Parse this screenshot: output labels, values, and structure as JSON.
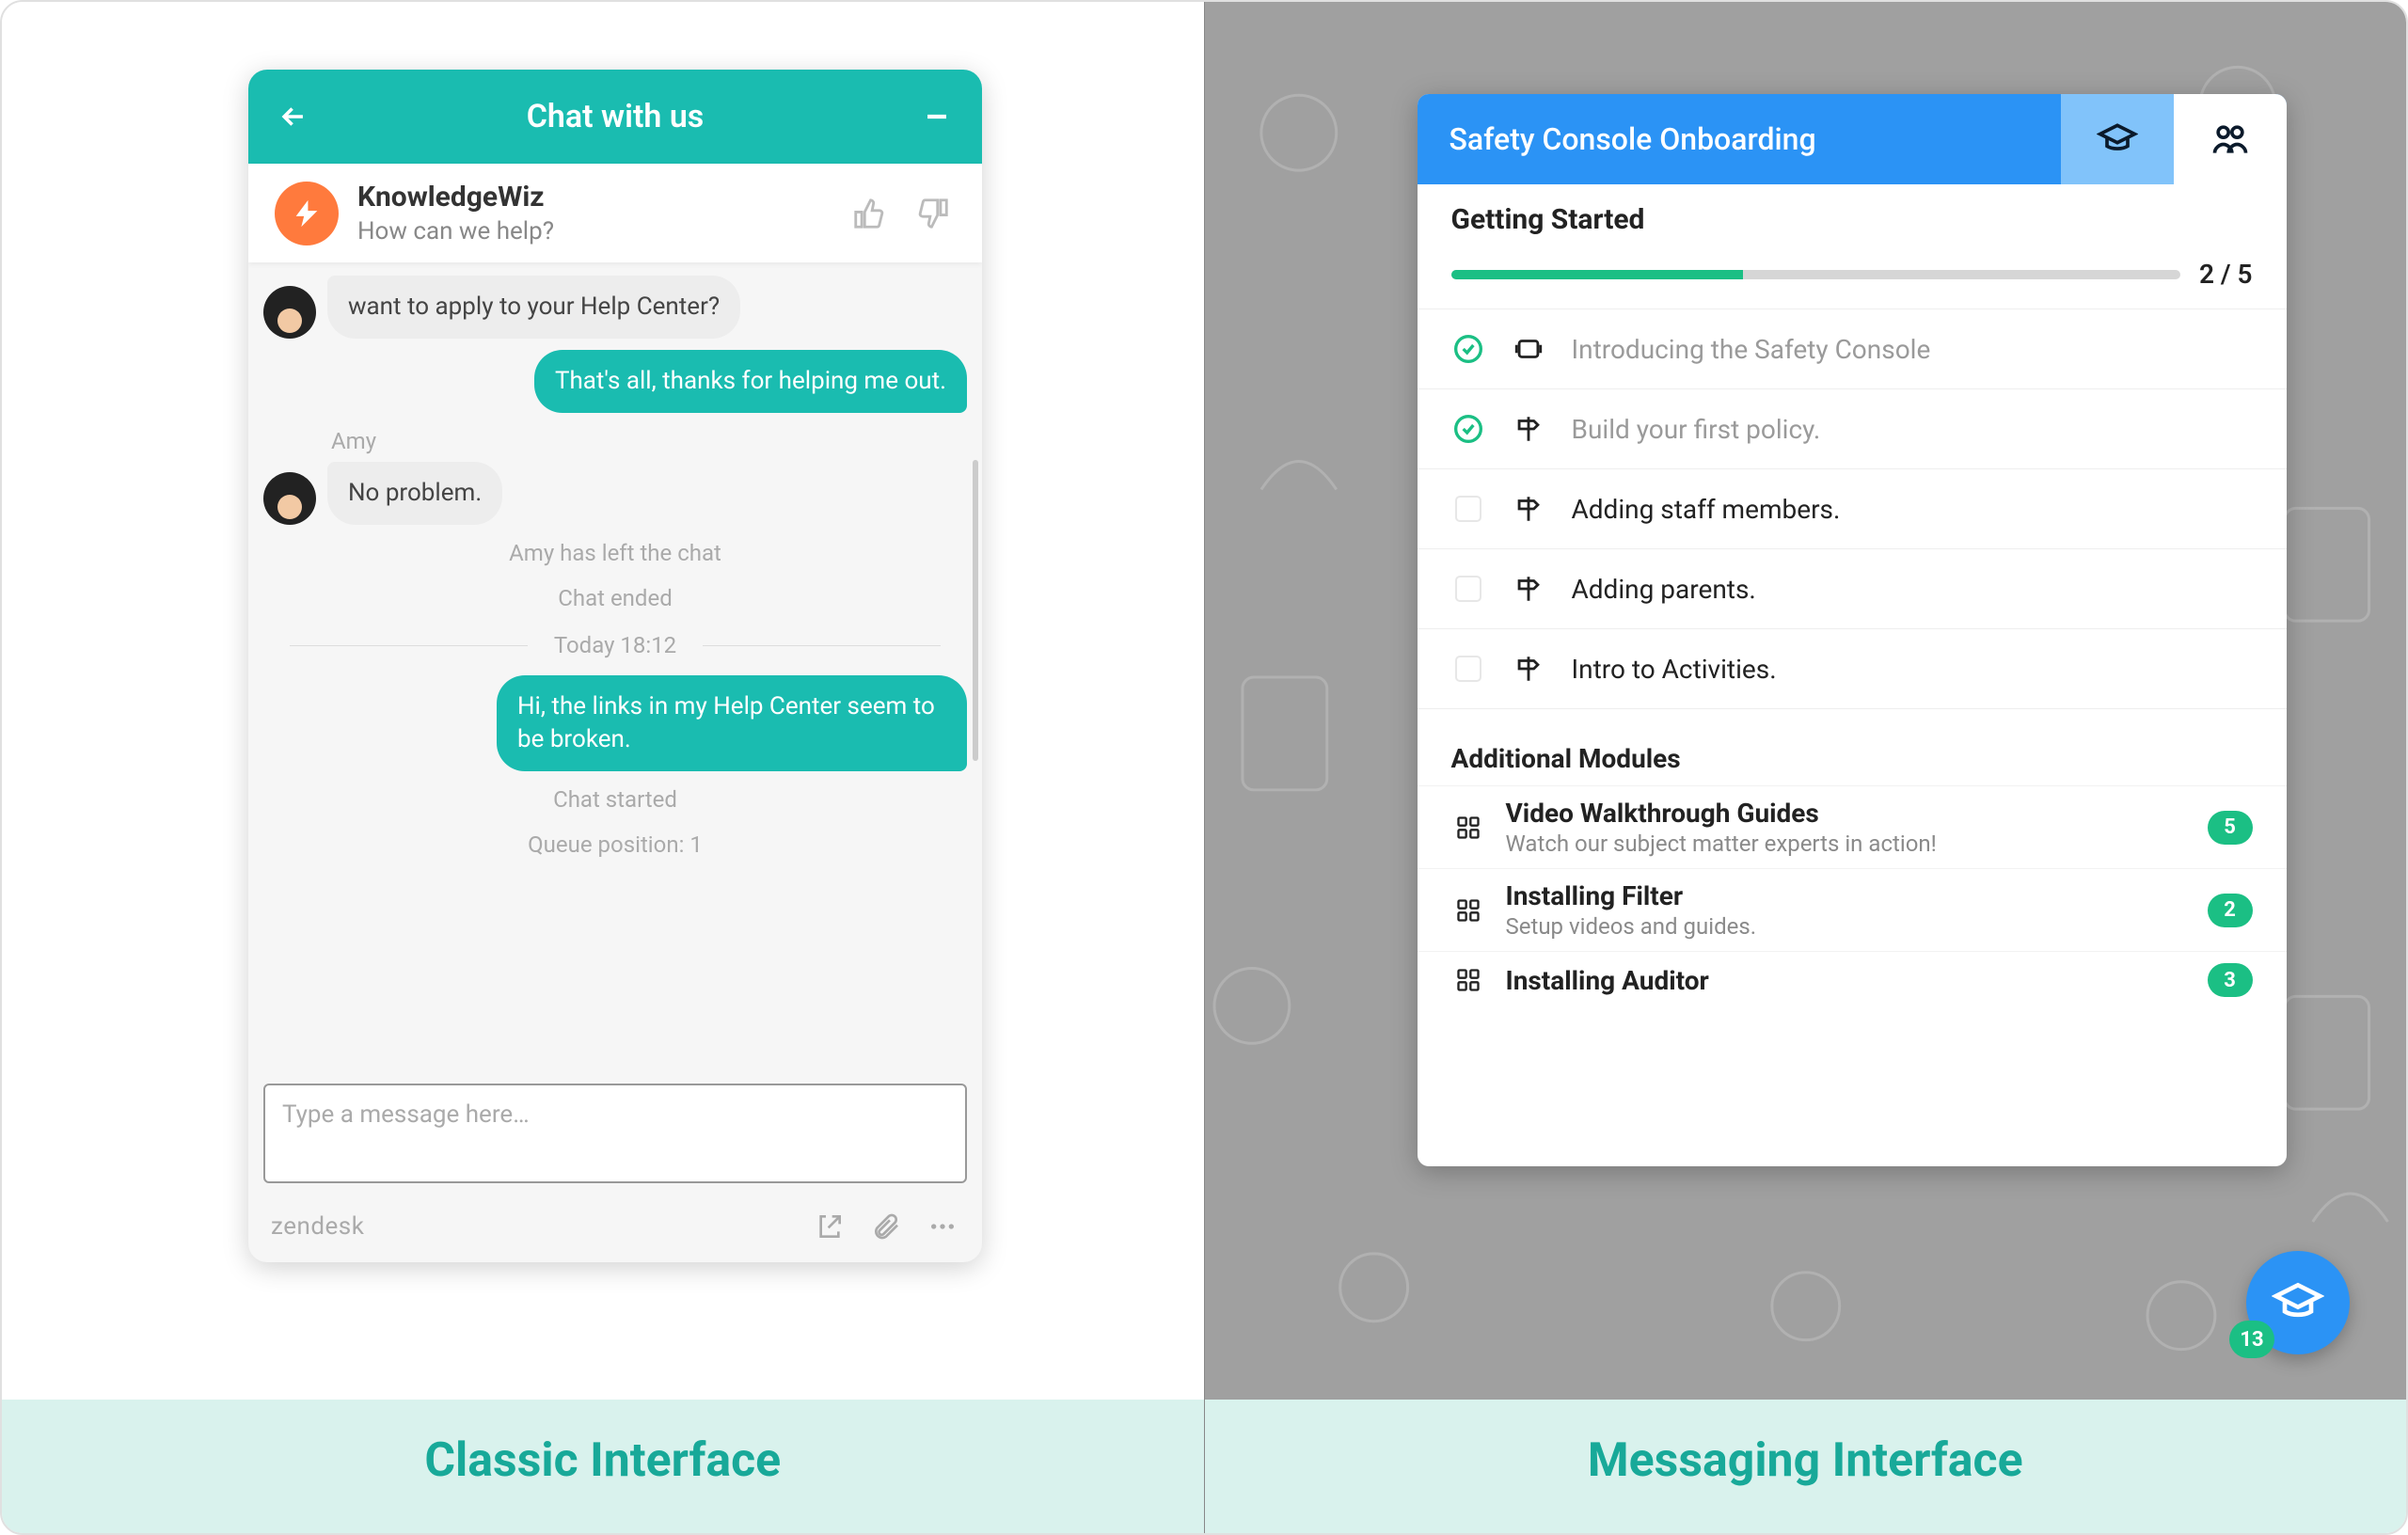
{
  "labels": {
    "left": "Classic Interface",
    "right": "Messaging Interface"
  },
  "chat": {
    "header_title": "Chat with us",
    "agent": {
      "name": "KnowledgeWiz",
      "subtitle": "How can we help?"
    },
    "messages": {
      "m0": "want to apply to your Help Center?",
      "m1": "That's all, thanks for helping me out.",
      "m2_name": "Amy",
      "m2": "No problem.",
      "m3": "Hi, the links in my Help Center seem to be broken."
    },
    "status": {
      "left": "Amy has left the chat",
      "ended": "Chat ended",
      "today": "Today 18:12",
      "started": "Chat started",
      "queue": "Queue position: 1"
    },
    "input_placeholder": "Type a message here…",
    "brand": "zendesk"
  },
  "onboard": {
    "title": "Safety Console Onboarding",
    "section": "Getting Started",
    "progress": {
      "pct": 40,
      "label": "2 / 5"
    },
    "steps": [
      {
        "label": "Introducing the Safety Console",
        "done": true,
        "icon": "video"
      },
      {
        "label": "Build your first policy.",
        "done": true,
        "icon": "signpost"
      },
      {
        "label": "Adding staff members.",
        "done": false,
        "icon": "signpost"
      },
      {
        "label": "Adding parents.",
        "done": false,
        "icon": "signpost"
      },
      {
        "label": "Intro to Activities.",
        "done": false,
        "icon": "signpost"
      }
    ],
    "additional_title": "Additional Modules",
    "modules": [
      {
        "title": "Video Walkthrough Guides",
        "sub": "Watch our subject matter experts in action!",
        "count": "5"
      },
      {
        "title": "Installing Filter",
        "sub": "Setup videos and guides.",
        "count": "2"
      },
      {
        "title": "Installing Auditor",
        "sub": "",
        "count": "3"
      }
    ],
    "float_badge": "13"
  }
}
